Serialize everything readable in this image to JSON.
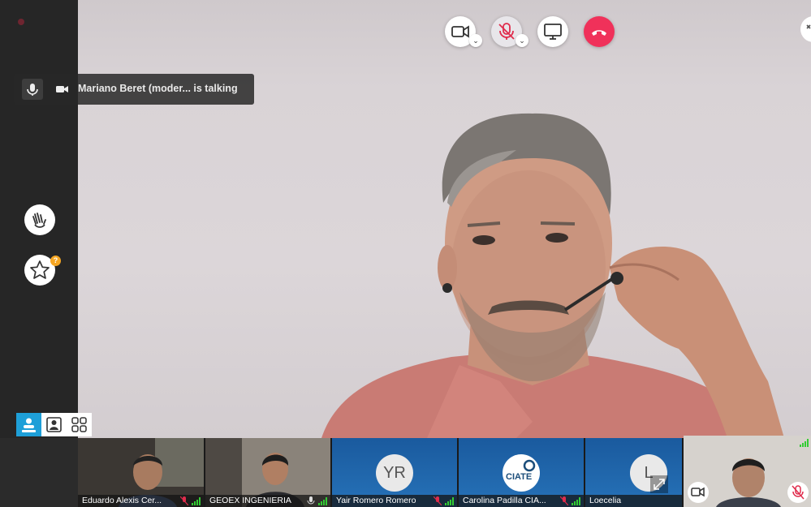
{
  "talking": {
    "text": "Mariano Beret (moder... is talking"
  },
  "toolbar": {
    "colors": {
      "hangup": "#f0315a",
      "mic_off": "#e02c4c"
    }
  },
  "side": {
    "favorites_badge": "?"
  },
  "participants": [
    {
      "name": "Eduardo Alexis Cer...",
      "type": "video",
      "mic_muted": true
    },
    {
      "name": "GEOEX INGENIERIA",
      "type": "video",
      "mic_muted": false
    },
    {
      "name": "Yair Romero Romero",
      "type": "avatar",
      "initials": "YR",
      "mic_muted": true
    },
    {
      "name": "Carolina Padilla CIA...",
      "type": "logo",
      "logo_text": "CIATE",
      "mic_muted": true
    },
    {
      "name": "Loecelia",
      "type": "avatar",
      "initials": "L",
      "mic_muted": false
    }
  ]
}
